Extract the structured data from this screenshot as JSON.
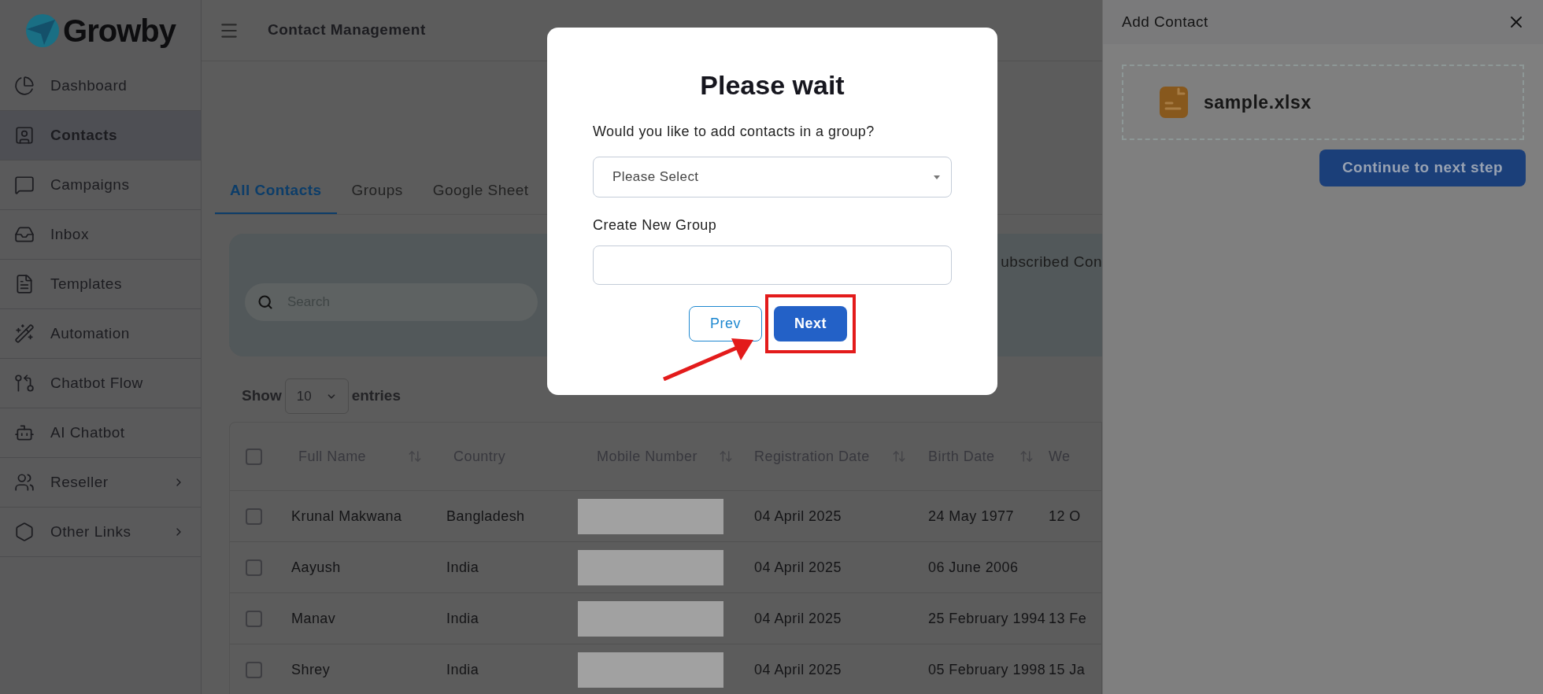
{
  "logo": {
    "text": "Growby"
  },
  "sidebar": {
    "items": [
      {
        "label": "Dashboard",
        "selected": false,
        "expandable": false
      },
      {
        "label": "Contacts",
        "selected": true,
        "expandable": false
      },
      {
        "label": "Campaigns",
        "selected": false,
        "expandable": false
      },
      {
        "label": "Inbox",
        "selected": false,
        "expandable": false
      },
      {
        "label": "Templates",
        "selected": false,
        "expandable": false
      },
      {
        "label": "Automation",
        "selected": false,
        "expandable": false
      },
      {
        "label": "Chatbot Flow",
        "selected": false,
        "expandable": false
      },
      {
        "label": "AI Chatbot",
        "selected": false,
        "expandable": false
      },
      {
        "label": "Reseller",
        "selected": false,
        "expandable": true
      },
      {
        "label": "Other Links",
        "selected": false,
        "expandable": true
      }
    ]
  },
  "top_bar": {
    "title": "Contact Management"
  },
  "tabs": [
    {
      "label": "All Contacts",
      "selected": true
    },
    {
      "label": "Groups",
      "selected": false
    },
    {
      "label": "Google Sheet",
      "selected": false
    }
  ],
  "filter_card": {
    "label": "ubscribed Con",
    "search": {
      "placeholder": "Search"
    }
  },
  "entries": {
    "prefix": "Show",
    "value": "10",
    "suffix": "entries"
  },
  "table": {
    "columns": [
      {
        "label": "Full Name",
        "sortable": true
      },
      {
        "label": "Country",
        "sortable": false
      },
      {
        "label": "Mobile Number",
        "sortable": true
      },
      {
        "label": "Registration Date",
        "sortable": true
      },
      {
        "label": "Birth Date",
        "sortable": true
      },
      {
        "label": "We",
        "sortable": false
      }
    ],
    "header_checkbox": {
      "checked": false
    },
    "rows": [
      {
        "checked": false,
        "cells": [
          "Krunal Makwana",
          "Bangladesh",
          "",
          "04 April 2025",
          "24 May 1977",
          "12 O"
        ],
        "mobile_redacted": true
      },
      {
        "checked": false,
        "cells": [
          "Aayush",
          "India",
          "",
          "04 April 2025",
          "06 June 2006",
          ""
        ],
        "mobile_redacted": true
      },
      {
        "checked": false,
        "cells": [
          "Manav",
          "India",
          "",
          "04 April 2025",
          "25 February 1994",
          "13 Fe"
        ],
        "mobile_redacted": true
      },
      {
        "checked": false,
        "cells": [
          "Shrey",
          "India",
          "",
          "04 April 2025",
          "05 February 1998",
          "15 Ja"
        ],
        "mobile_redacted": true
      }
    ]
  },
  "modal": {
    "title": "Please wait",
    "question": "Would you like to add contacts in a group?",
    "group_select": {
      "placeholder": "Please Select"
    },
    "new_group": {
      "label": "Create New Group"
    },
    "buttons": [
      {
        "label": "Prev",
        "kind": "outline",
        "highlighted": false
      },
      {
        "label": "Next",
        "kind": "primary",
        "highlighted": true
      }
    ]
  },
  "side_panel": {
    "title": "Add Contact",
    "file": {
      "name": "sample.xlsx"
    },
    "button": "Continue to next step"
  }
}
